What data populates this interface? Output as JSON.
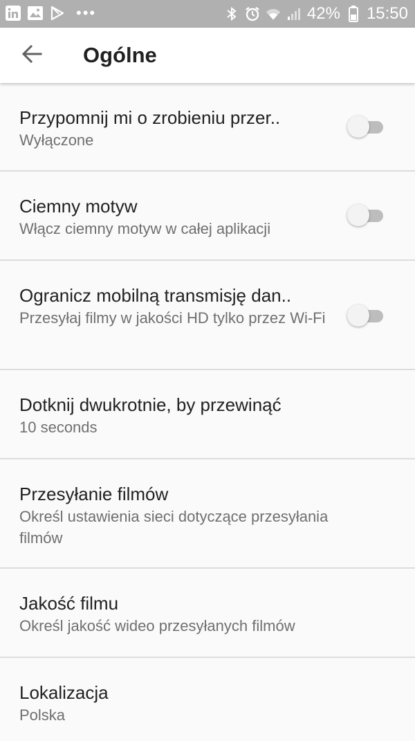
{
  "status_bar": {
    "battery": "42%",
    "time": "15:50",
    "left_icons": [
      "linkedin-icon",
      "gallery-icon",
      "play-store-icon",
      "more-notifications-icon"
    ],
    "right_icons": [
      "bluetooth-icon",
      "alarm-icon",
      "wifi-icon",
      "signal-icon",
      "battery-icon"
    ]
  },
  "app_bar": {
    "title": "Ogólne",
    "back_icon": "arrow-back-icon"
  },
  "settings": [
    {
      "title": "Przypomnij mi o zrobieniu przer..",
      "subtitle": "Wyłączone",
      "toggle": true,
      "enabled": false
    },
    {
      "title": "Ciemny motyw",
      "subtitle": "Włącz ciemny motyw w całej aplikacji",
      "toggle": true,
      "enabled": false
    },
    {
      "title": "Ogranicz mobilną transmisję dan..",
      "subtitle": "Przesyłaj filmy w jakości HD tylko przez Wi-Fi",
      "toggle": true,
      "enabled": false
    },
    {
      "title": "Dotknij dwukrotnie, by przewinąć",
      "subtitle": "10 seconds",
      "toggle": false
    },
    {
      "title": "Przesyłanie filmów",
      "subtitle": "Określ ustawienia sieci dotyczące przesyłania filmów",
      "toggle": false
    },
    {
      "title": "Jakość filmu",
      "subtitle": "Określ jakość wideo przesyłanych filmów",
      "toggle": false
    },
    {
      "title": "Lokalizacja",
      "subtitle": "Polska",
      "toggle": false
    }
  ],
  "colors": {
    "status_bar_bg": "#b0b0b0",
    "app_bar_bg": "#ffffff",
    "background": "#fafafa",
    "divider": "#dcdcdc",
    "primary_text": "#212121",
    "secondary_text": "#6f6f6f",
    "switch_track_off": "#bdbdbd",
    "switch_thumb_off": "#f3f3f3"
  }
}
